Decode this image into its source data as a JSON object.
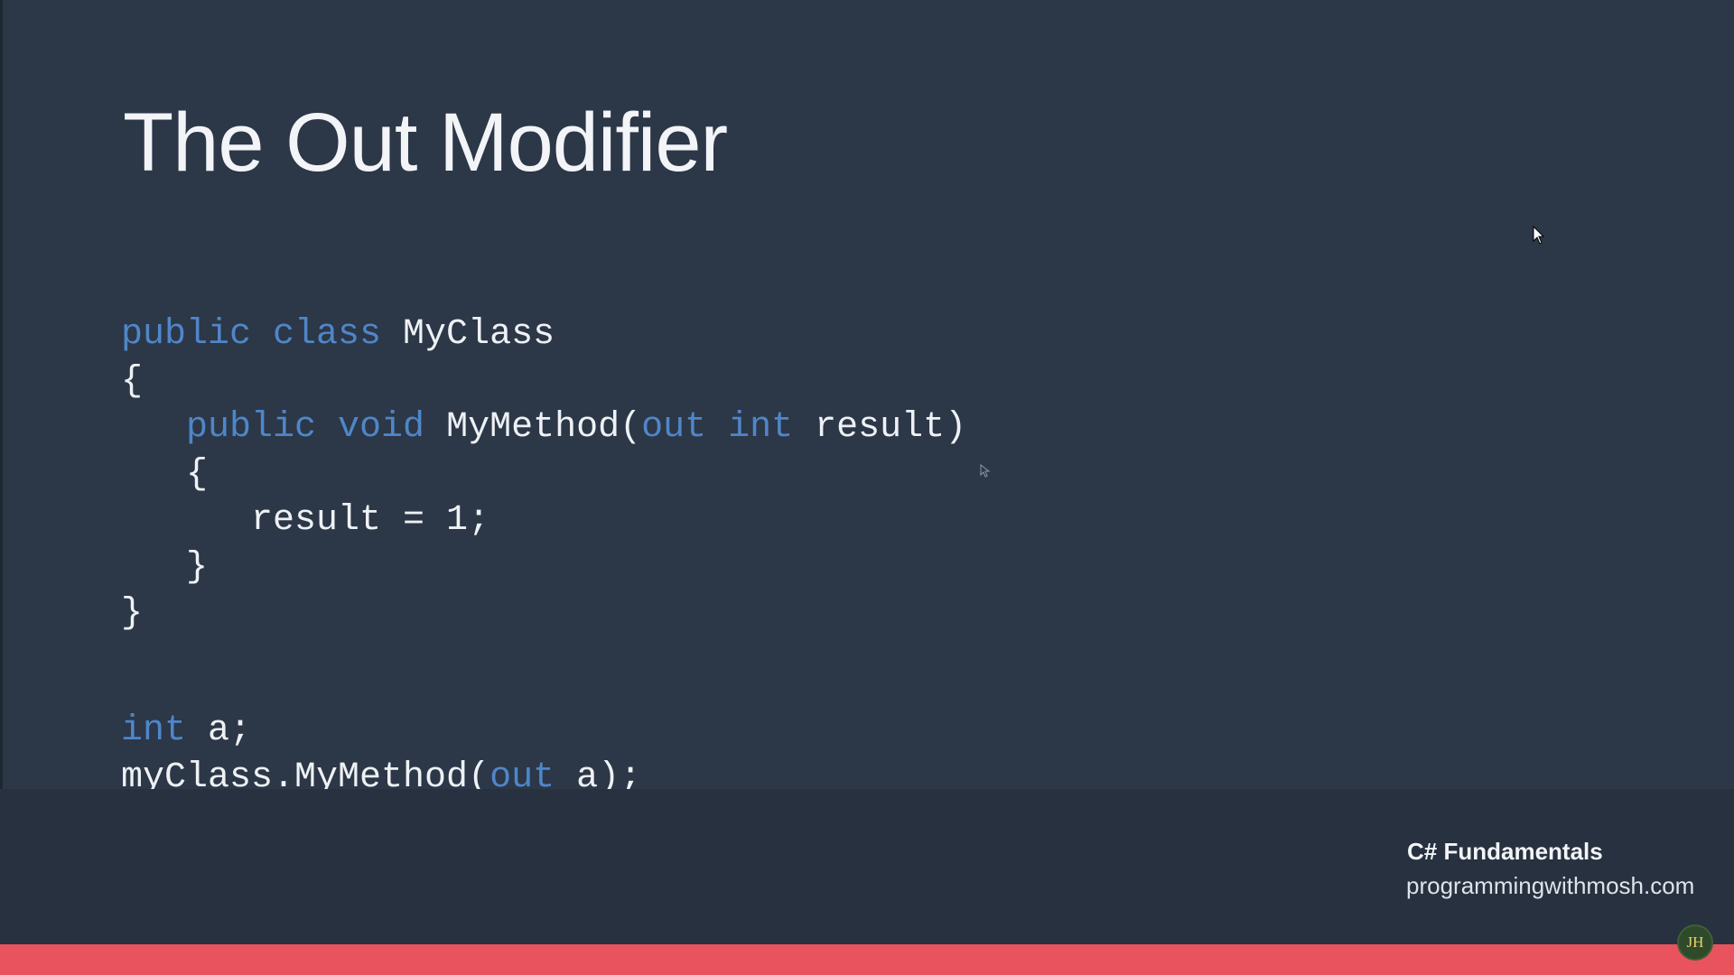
{
  "slide": {
    "title": "The Out Modifier",
    "code": [
      [
        {
          "t": "public class",
          "kw": true
        },
        {
          "t": " MyClass",
          "kw": false
        }
      ],
      [
        {
          "t": "{",
          "kw": false
        }
      ],
      [
        {
          "t": "   ",
          "kw": false
        },
        {
          "t": "public void",
          "kw": true
        },
        {
          "t": " MyMethod(",
          "kw": false
        },
        {
          "t": "out int",
          "kw": true
        },
        {
          "t": " result)",
          "kw": false
        }
      ],
      [
        {
          "t": "   {",
          "kw": false
        }
      ],
      [
        {
          "t": "      result = 1;",
          "kw": false
        }
      ],
      [
        {
          "t": "   }",
          "kw": false
        }
      ],
      [
        {
          "t": "}",
          "kw": false
        }
      ],
      [],
      [
        {
          "t": "int",
          "kw": true
        },
        {
          "t": " a;",
          "kw": false
        }
      ],
      [
        {
          "t": "myClass.MyMethod(",
          "kw": false
        },
        {
          "t": "out",
          "kw": true
        },
        {
          "t": " a);",
          "kw": false
        }
      ]
    ]
  },
  "branding": {
    "course": "C# Fundamentals",
    "site": "programmingwithmosh.com"
  },
  "player": {
    "progress": 1.0,
    "avatar_initials": "JH"
  },
  "colors": {
    "background": "#2c3747",
    "keyword": "#4f86c9",
    "text": "#eef1f5",
    "progress": "#e9535d"
  },
  "icons": [
    "mouse-pointer-icon"
  ]
}
